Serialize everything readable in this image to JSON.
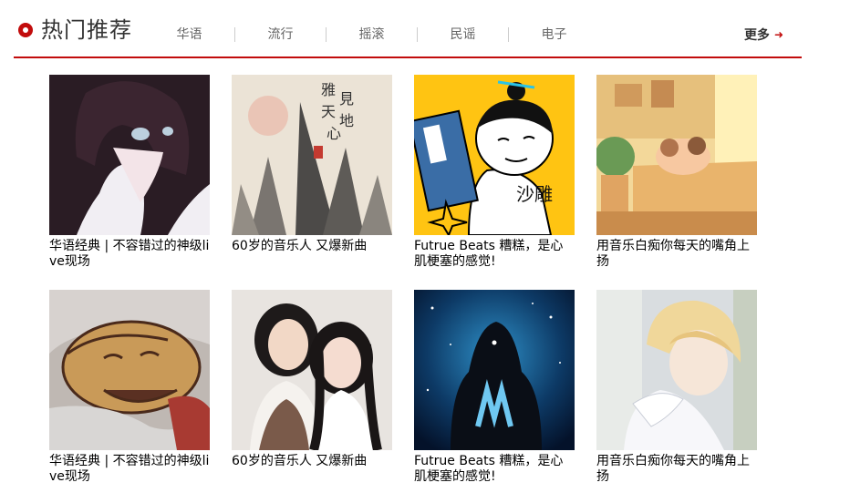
{
  "header": {
    "title": "热门推荐",
    "tabs": [
      "华语",
      "流行",
      "摇滚",
      "民谣",
      "电子"
    ],
    "more_label": "更多",
    "accent_color": "#c20c0c"
  },
  "playlists": [
    {
      "title": "华语经典 | 不容错过的神级live现场",
      "cover": "anime-girl-cover"
    },
    {
      "title": "60岁的音乐人 又爆新曲",
      "cover": "ink-mountain-cover"
    },
    {
      "title": "Futrue Beats 糟糕，是心肌梗塞的感觉!",
      "cover": "cartoon-boy-cover"
    },
    {
      "title": "用音乐白痴你每天的嘴角上扬",
      "cover": "illustrated-room-cover"
    },
    {
      "title": "华语经典 | 不容错过的神级live现场",
      "cover": "sleeping-cartoon-cover"
    },
    {
      "title": "60岁的音乐人 又爆新曲",
      "cover": "costume-couple-cover"
    },
    {
      "title": "Futrue Beats 糟糕，是心肌梗塞的感觉!",
      "cover": "hooded-figure-cover"
    },
    {
      "title": "用音乐白痴你每天的嘴角上扬",
      "cover": "anime-boy-cover"
    }
  ]
}
